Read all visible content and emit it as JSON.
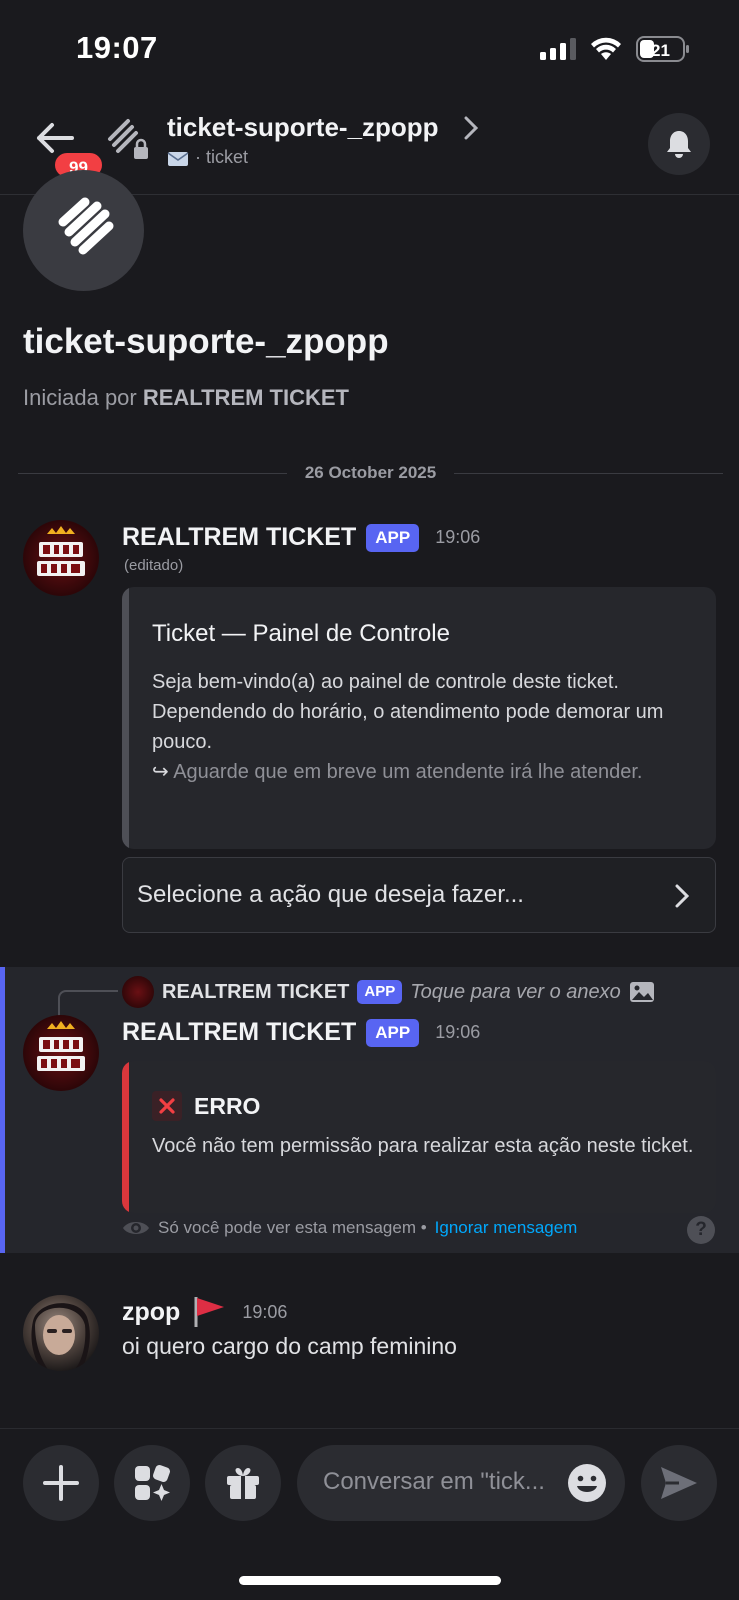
{
  "status_bar": {
    "time": "19:07",
    "battery": "21"
  },
  "header": {
    "badge_count": "99",
    "title": "ticket-suporte-_zpopp",
    "subtitle": "· ticket"
  },
  "thread": {
    "name": "ticket-suporte-_zpopp",
    "started_by_prefix": "Iniciada por ",
    "started_by_name": "REALTREM TICKET",
    "date": "26 October 2025"
  },
  "messages": {
    "first": {
      "author": "REALTREM TICKET",
      "tag": "APP",
      "time": "19:06",
      "edited": "(editado)",
      "embed": {
        "title": "Ticket — Painel de Controle",
        "line1": "Seja bem-vindo(a) ao painel de controle deste ticket. Dependendo do horário, o atendimento pode demorar um pouco.",
        "line2_icon": "↪",
        "line2": "Aguarde que em breve um atendente irá lhe atender.",
        "bar_color": "#4e4f56"
      },
      "select_placeholder": "Selecione a ação que deseja fazer..."
    },
    "second": {
      "reply_author": "REALTREM TICKET",
      "reply_tag": "APP",
      "reply_text": "Toque para ver o anexo",
      "author": "REALTREM TICKET",
      "tag": "APP",
      "time": "19:06",
      "embed": {
        "title": "ERRO",
        "description": " Você não tem permissão para realizar esta ação neste ticket.",
        "bar_color": "#da373c"
      },
      "only_you": "Só você pode ver esta mensagem •",
      "dismiss": "Ignorar mensagem",
      "help": "?"
    },
    "third": {
      "author": "zpop",
      "time": "19:06",
      "text": "oi quero cargo do camp feminino"
    }
  },
  "input": {
    "placeholder": "Conversar em \"tick..."
  },
  "icons": {
    "back": "arrow-left-icon",
    "bell": "bell-icon",
    "plus": "plus-icon",
    "apps": "apps-icon",
    "gift": "gift-icon",
    "emoji": "emoji-icon",
    "send": "send-icon"
  },
  "colors": {
    "accent": "#5865f2",
    "danger": "#da373c",
    "link": "#00a8fc"
  }
}
